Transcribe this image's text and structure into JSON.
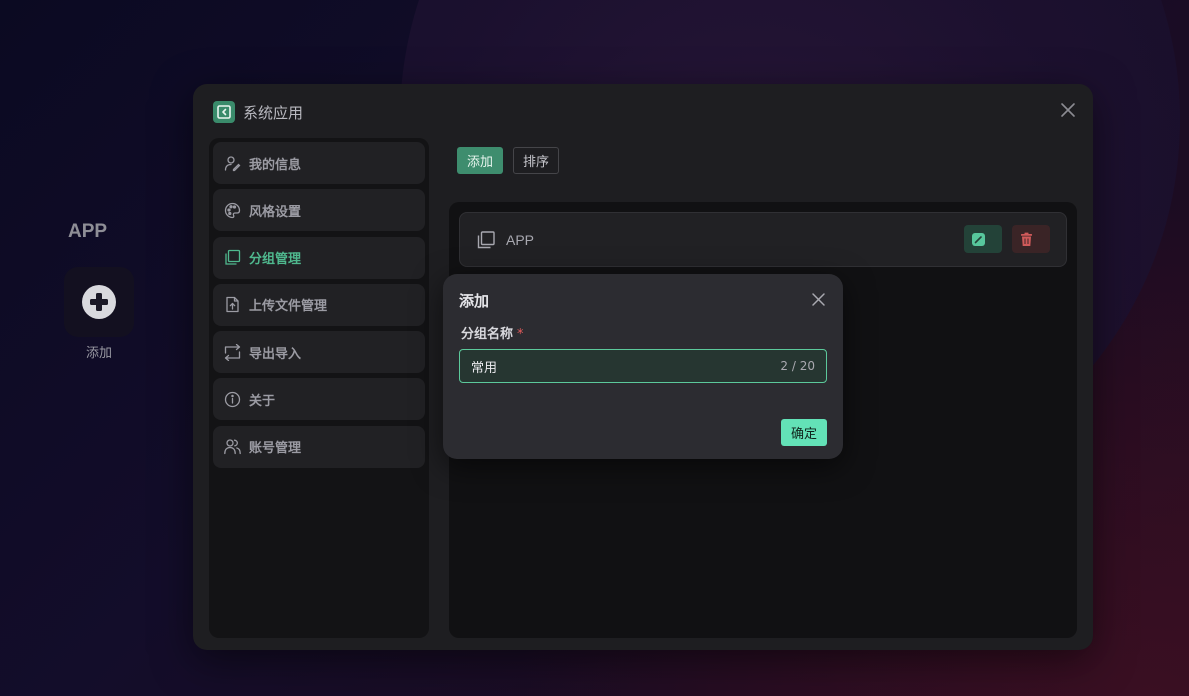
{
  "desktop": {
    "group_title": "APP",
    "add_label": "添加"
  },
  "window": {
    "title": "系统应用"
  },
  "sidebar": {
    "items": [
      {
        "label": "我的信息",
        "icon": "user-edit-icon",
        "active": false
      },
      {
        "label": "风格设置",
        "icon": "palette-icon",
        "active": false
      },
      {
        "label": "分组管理",
        "icon": "copy-icon",
        "active": true
      },
      {
        "label": "上传文件管理",
        "icon": "file-upload-icon",
        "active": false
      },
      {
        "label": "导出导入",
        "icon": "import-export-icon",
        "active": false
      },
      {
        "label": "关于",
        "icon": "info-icon",
        "active": false
      },
      {
        "label": "账号管理",
        "icon": "users-icon",
        "active": false
      }
    ]
  },
  "toolbar": {
    "add_label": "添加",
    "sort_label": "排序"
  },
  "groups": [
    {
      "name": "APP"
    }
  ],
  "dialog": {
    "title": "添加",
    "field_label": "分组名称",
    "required_mark": "*",
    "value": "常用",
    "char_count": "2 / 20",
    "confirm_label": "确定"
  },
  "colors": {
    "accent": "#63e2b7",
    "accent_dark": "#3e8d6e",
    "danger": "#e35b5b"
  }
}
